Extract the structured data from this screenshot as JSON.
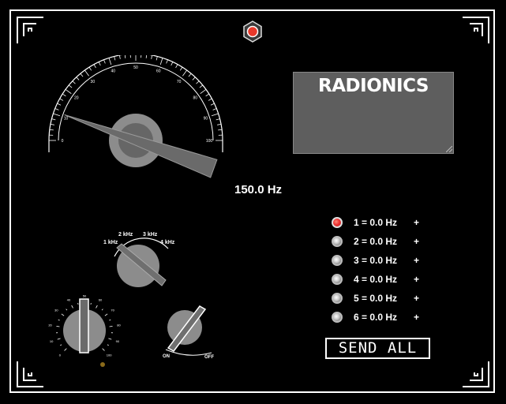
{
  "gauge": {
    "ticks": [
      "0",
      "10",
      "20",
      "30",
      "40",
      "50",
      "60",
      "70",
      "80",
      "90",
      "100"
    ],
    "needle_value": 11
  },
  "display": {
    "text": "RADIONICS"
  },
  "frequency_readout": "150.0 Hz",
  "range_selector": {
    "labels": [
      "1 kHz",
      "2 kHz",
      "3 kHz",
      "4 kHz"
    ],
    "selected": "1 kHz"
  },
  "fine_knob": {
    "ticks": [
      "0",
      "10",
      "20",
      "30",
      "40",
      "50",
      "60",
      "70",
      "80",
      "90",
      "100"
    ]
  },
  "power_switch": {
    "on_label": "ON",
    "off_label": "OFF"
  },
  "presets": [
    {
      "label": "1 = 0.0 Hz",
      "plus": "+",
      "selected": true
    },
    {
      "label": "2 = 0.0 Hz",
      "plus": "+",
      "selected": false
    },
    {
      "label": "3 = 0.0 Hz",
      "plus": "+",
      "selected": false
    },
    {
      "label": "4 = 0.0 Hz",
      "plus": "+",
      "selected": false
    },
    {
      "label": "5 = 0.0 Hz",
      "plus": "+",
      "selected": false
    },
    {
      "label": "6 = 0.0 Hz",
      "plus": "+",
      "selected": false
    }
  ],
  "send_all_label": "SEND ALL",
  "colors": {
    "indicator_led": "#e8392b",
    "knob": "#8c8c8c",
    "panel": "#000000",
    "display_bg": "#5e5e5e"
  }
}
